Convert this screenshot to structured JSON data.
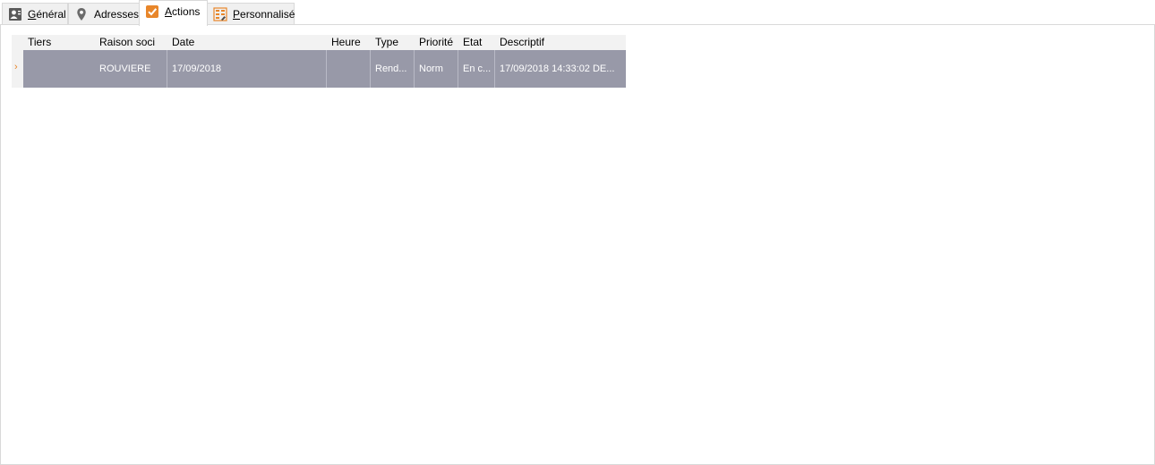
{
  "tabs": [
    {
      "prefix": "",
      "underline": "G",
      "rest": "énéral",
      "icon": "contact-card-icon"
    },
    {
      "prefix": "",
      "underline": "",
      "rest": "Adresses",
      "icon": "map-pin-icon"
    },
    {
      "prefix": "",
      "underline": "A",
      "rest": "ctions",
      "icon": "checkbox-checked-icon"
    },
    {
      "prefix": "",
      "underline": "P",
      "rest": "ersonnalisé",
      "icon": "custom-grid-icon"
    }
  ],
  "active_tab": "Actions",
  "grid": {
    "columns": [
      "Tiers",
      "Raison soci",
      "Date",
      "Heure",
      "Type",
      "Priorité",
      "Etat",
      "Descriptif"
    ],
    "rows": [
      {
        "tiers": "",
        "raison_sociale": "ROUVIERE",
        "date": "17/09/2018",
        "heure": "",
        "type": "Rend...",
        "priorite": "Norm",
        "etat": "En c...",
        "descriptif": "17/09/2018 14:33:02 DE..."
      }
    ],
    "row_indicator": "›"
  },
  "colors": {
    "accent": "#e8862a",
    "selected_row": "#9899a8",
    "header_bg": "#f2f2f2"
  }
}
